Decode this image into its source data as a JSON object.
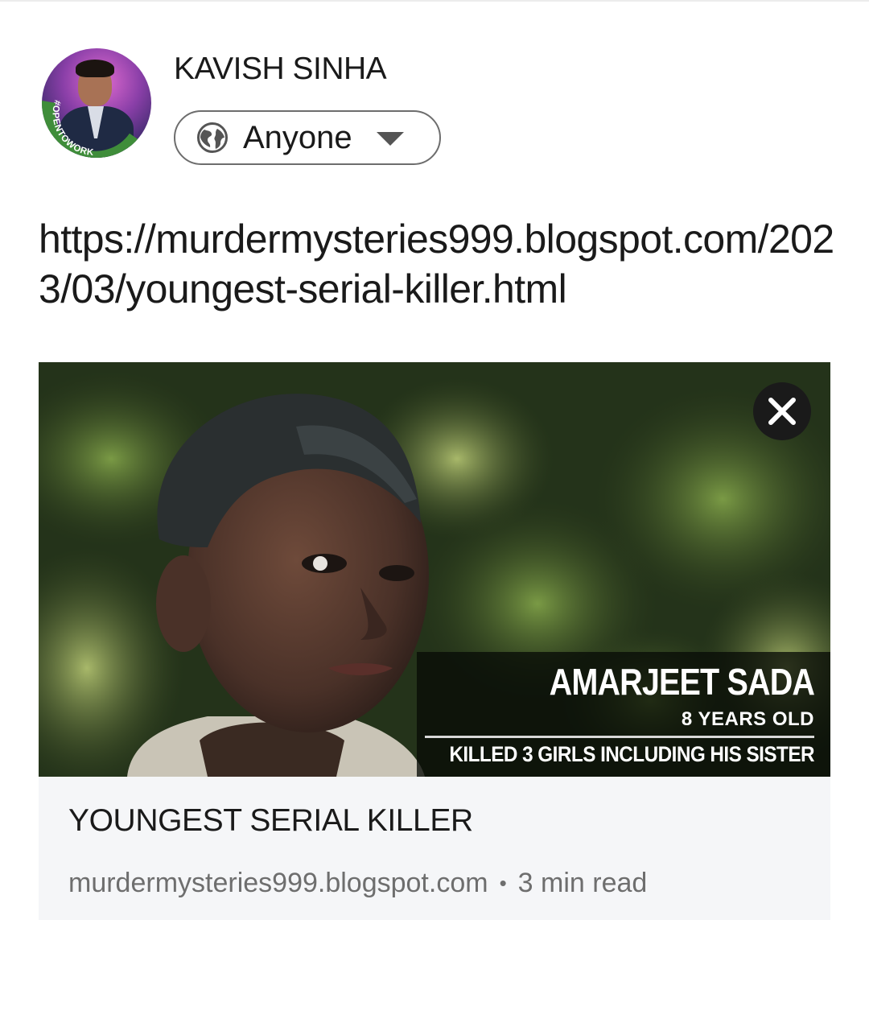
{
  "author": {
    "name": "KAVISH SINHA",
    "badge_text": "#OPENTOWORK"
  },
  "visibility": {
    "label": "Anyone",
    "icon": "globe-icon",
    "dropdown_icon": "caret-down-icon"
  },
  "post": {
    "text": "https://murdermysteries999.blogspot.com/2023/03/youngest-serial-killer.html"
  },
  "link_preview": {
    "image_caption": {
      "name": "AMARJEET SADA",
      "age": "8 YEARS OLD",
      "description": "KILLED 3 GIRLS INCLUDING HIS SISTER"
    },
    "close_icon": "close-icon",
    "title": "YOUNGEST SERIAL KILLER",
    "domain": "murdermysteries999.blogspot.com",
    "separator": "•",
    "read_time": "3 min read"
  },
  "colors": {
    "badge_green": "#3f8d3a",
    "text_primary": "#1a1a1a",
    "text_secondary": "#6e6e6e",
    "card_background": "#f5f6f8"
  }
}
